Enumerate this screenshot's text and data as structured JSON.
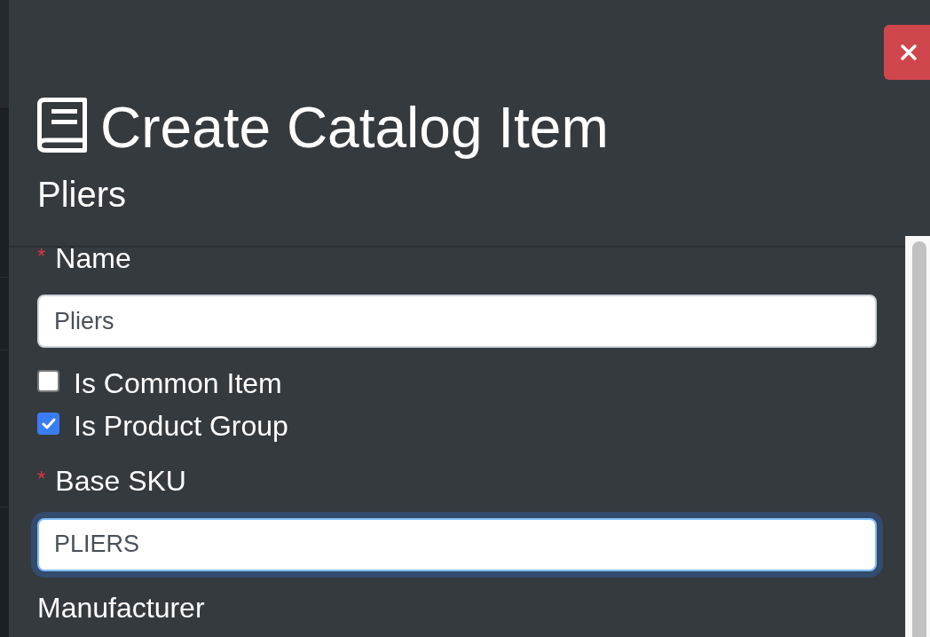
{
  "drawer": {
    "title": "Create Catalog Item",
    "subtitle": "Pliers",
    "fields": [
      {
        "kind": "text",
        "required_mark": "*",
        "label": "Name",
        "value": "Pliers",
        "focused": false
      },
      {
        "kind": "checkbox",
        "label": "Is Common Item",
        "checked": false
      },
      {
        "kind": "checkbox",
        "label": "Is Product Group",
        "checked": true
      },
      {
        "kind": "text",
        "required_mark": "*",
        "label": "Base SKU",
        "value": "PLIERS",
        "focused": true
      },
      {
        "kind": "label",
        "label": "Manufacturer"
      }
    ]
  }
}
